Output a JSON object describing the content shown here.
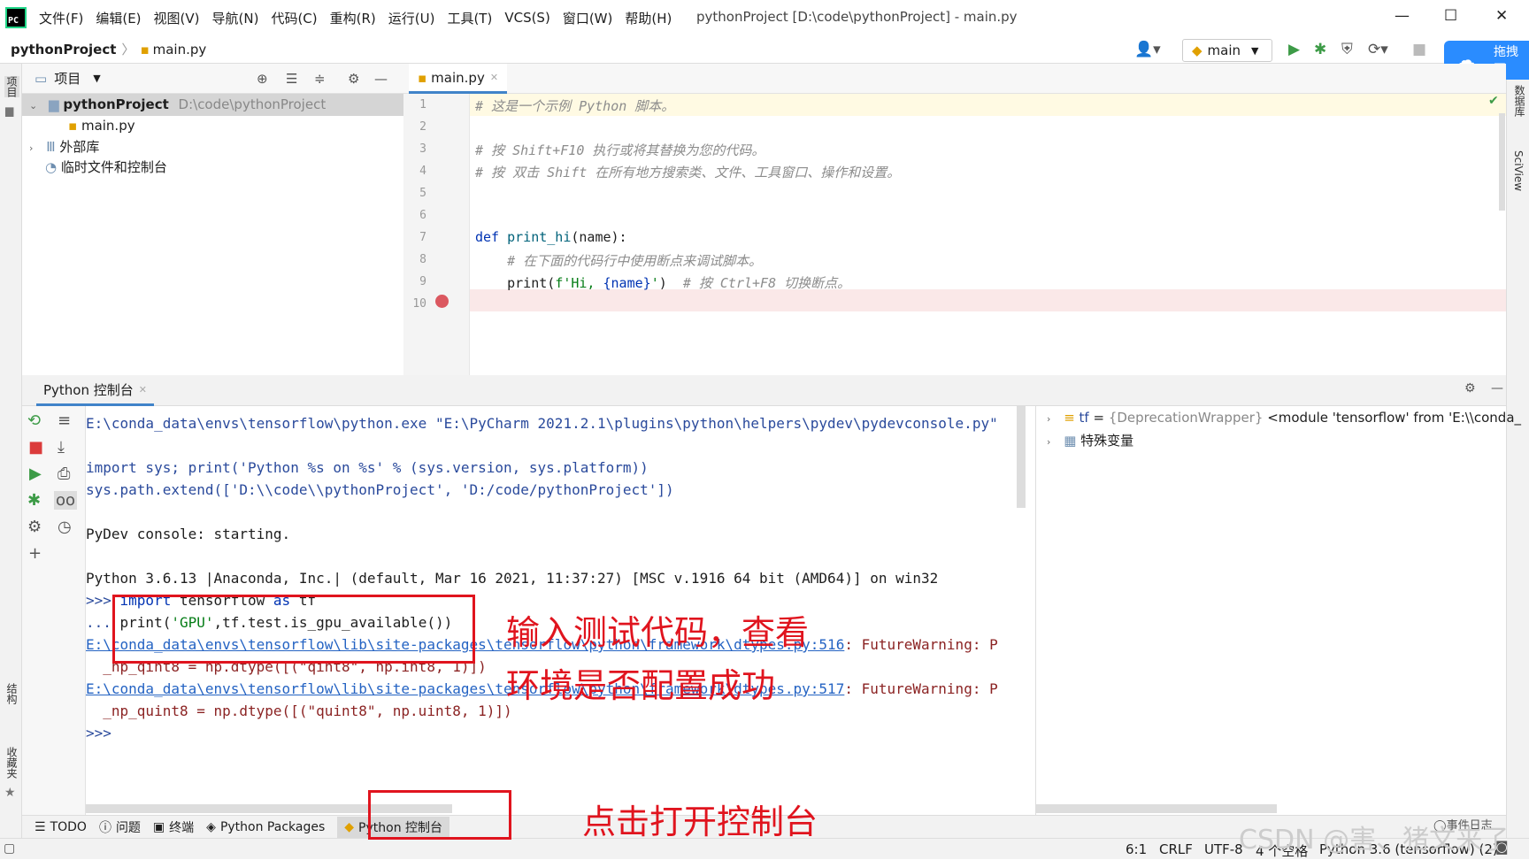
{
  "menu": [
    "文件(F)",
    "编辑(E)",
    "视图(V)",
    "导航(N)",
    "代码(C)",
    "重构(R)",
    "运行(U)",
    "工具(T)",
    "VCS(S)",
    "窗口(W)",
    "帮助(H)"
  ],
  "window_title": "pythonProject [D:\\code\\pythonProject] - main.py",
  "breadcrumb": {
    "project": "pythonProject",
    "file": "main.py"
  },
  "run_config": "main",
  "baidu_label": "拖拽至",
  "left_stripe": {
    "project": "项目",
    "structure": "结构",
    "favorites": "收藏夹"
  },
  "right_stripe": {
    "database": "数据库",
    "sciview": "SciView"
  },
  "project_panel": {
    "title": "项目",
    "root_name": "pythonProject",
    "root_path": "D:\\code\\pythonProject",
    "file": "main.py",
    "external_libs": "外部库",
    "scratches": "临时文件和控制台"
  },
  "editor": {
    "tab": "main.py",
    "line_numbers": [
      "1",
      "2",
      "3",
      "4",
      "5",
      "6",
      "7",
      "8",
      "9",
      "10"
    ],
    "lines": {
      "l1": "# 这是一个示例 Python 脚本。",
      "l3": "# 按 Shift+F10 执行或将其替换为您的代码。",
      "l4": "# 按 双击 Shift 在所有地方搜索类、文件、工具窗口、操作和设置。",
      "l7_kw": "def ",
      "l7_fn": "print_hi",
      "l7_rest": "(name):",
      "l8": "    # 在下面的代码行中使用断点来调试脚本。",
      "l9_a": "    print(",
      "l9_str": "f'Hi, ",
      "l9_b": "{name}",
      "l9_str2": "'",
      "l9_c": ")  ",
      "l9_cm": "# 按 Ctrl+F8 切换断点。"
    }
  },
  "console": {
    "tab": "Python 控制台",
    "lines": {
      "c1": "E:\\conda_data\\envs\\tensorflow\\python.exe \"E:\\PyCharm 2021.2.1\\plugins\\python\\helpers\\pydev\\pydevconsole.py\"",
      "c3": "import sys; print('Python %s on %s' % (sys.version, sys.platform))",
      "c4": "sys.path.extend(['D:\\\\code\\\\pythonProject', 'D:/code/pythonProject'])",
      "c6": "PyDev console: starting.",
      "c8": "Python 3.6.13 |Anaconda, Inc.| (default, Mar 16 2021, 11:37:27) [MSC v.1916 64 bit (AMD64)] on win32",
      "p1": ">>> ",
      "i1_kw": "import",
      "i1_a": " tensorflow ",
      "i1_kw2": "as",
      "i1_b": " tf",
      "p2": "... ",
      "i2_a": "print(",
      "i2_str": "'GPU'",
      "i2_b": ",tf.test.is_gpu_available())",
      "w1_link": "E:\\conda_data\\envs\\tensorflow\\lib\\site-packages\\tensorflow\\python\\framework\\dtypes.py:516",
      "w1_rest": ": FutureWarning: P",
      "w1_code": "  _np_qint8 = np.dtype([(\"qint8\", np.int8, 1)])",
      "w2_link": "E:\\conda_data\\envs\\tensorflow\\lib\\site-packages\\tensorflow\\python\\framework\\dtypes.py:517",
      "w2_rest": ": FutureWarning: P",
      "w2_code": "  _np_quint8 = np.dtype([(\"quint8\", np.uint8, 1)])",
      "prompt": ">>>"
    }
  },
  "variables": {
    "tf_name": "tf",
    "tf_eq": " = ",
    "tf_type": "{DeprecationWrapper}",
    "tf_value": " <module 'tensorflow' from 'E:\\\\conda_",
    "special": "特殊变量"
  },
  "bottom_tabs": [
    "TODO",
    "问题",
    "终端",
    "Python Packages",
    "Python 控制台"
  ],
  "status": {
    "pos": "6:1",
    "eol": "CRLF",
    "enc": "UTF-8",
    "indent": "4 个空格",
    "interpreter": "Python 3.6 (tensorflow) (2)",
    "event_log": "事件日志"
  },
  "annotations": {
    "a1": "输入测试代码，查看",
    "a2": "环境是否配置成功",
    "a3": "点击打开控制台"
  },
  "watermark": "CSDN @害、猪文来了",
  "colors": {
    "accent": "#4083c9",
    "annotation": "#e0141e",
    "breakpoint": "#db5860"
  }
}
